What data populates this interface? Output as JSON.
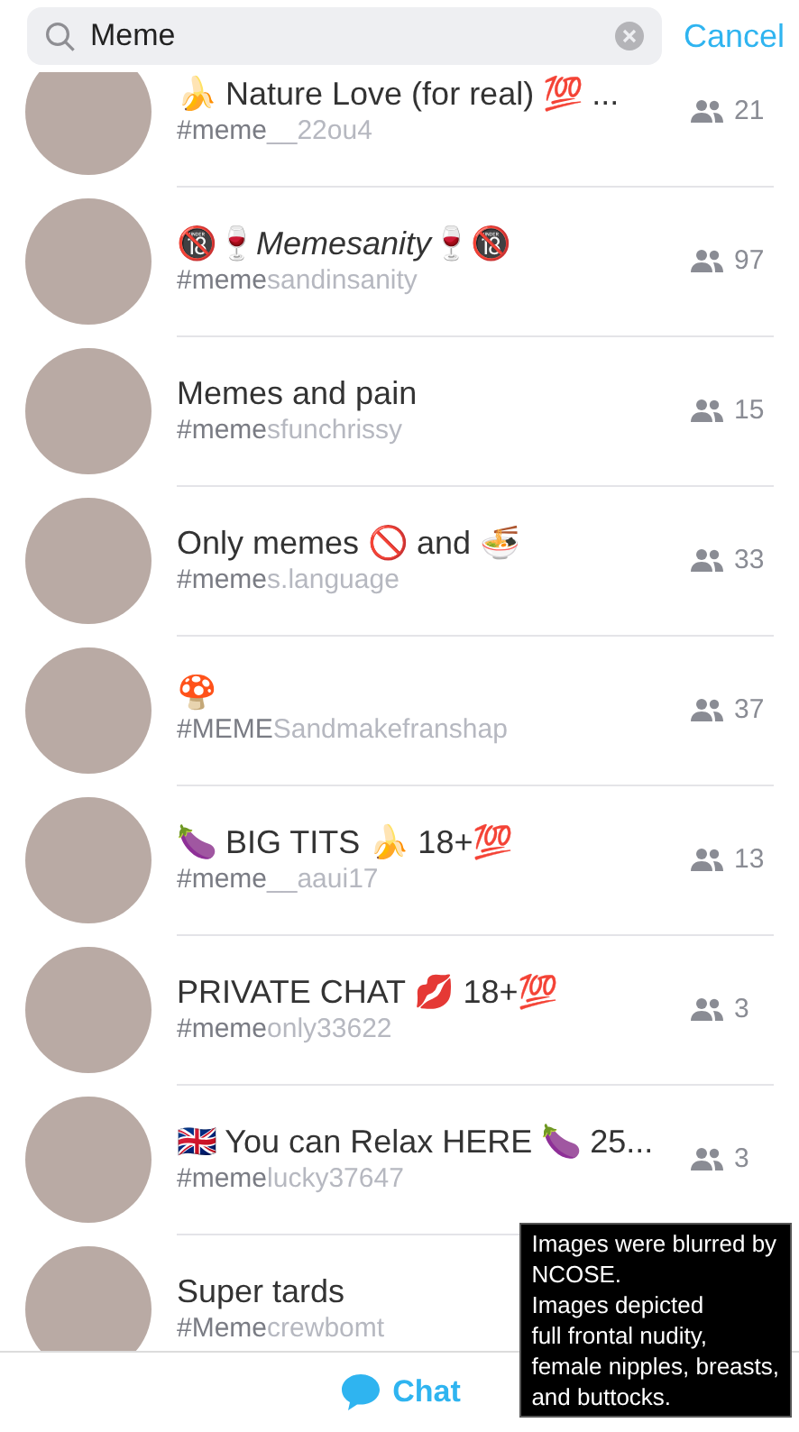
{
  "search": {
    "value": "Meme",
    "cancel": "Cancel"
  },
  "results": [
    {
      "name": "🍌 Nature Love (for real) 💯 ...",
      "handle_match": "#meme",
      "handle_rest": "__22ou4",
      "members": "21"
    },
    {
      "name": "🔞🍷*Memesanity*🍷🔞",
      "handle_match": "#meme",
      "handle_rest": "sandinsanity",
      "members": "97"
    },
    {
      "name": "Memes and pain",
      "handle_match": "#meme",
      "handle_rest": "sfunchrissy",
      "members": "15"
    },
    {
      "name": "Only memes 🚫 and 🍜",
      "handle_match": "#meme",
      "handle_rest": "s.language",
      "members": "33"
    },
    {
      "name": "🍄",
      "handle_match": "#MEME",
      "handle_rest": "Sandmakefranshap",
      "members": "37"
    },
    {
      "name": "🍆 BIG TITS 🍌 18+💯",
      "handle_match": "#meme",
      "handle_rest": "__aaui17",
      "members": "13"
    },
    {
      "name": "PRIVATE CHAT 💋 18+💯",
      "handle_match": "#meme",
      "handle_rest": "only33622",
      "members": "3"
    },
    {
      "name": "🇬🇧 You can Relax HERE 🍆 25...",
      "handle_match": "#meme",
      "handle_rest": "lucky37647",
      "members": "3"
    },
    {
      "name": "Super tards",
      "handle_match": "#Meme",
      "handle_rest": "crewbomt"
    }
  ],
  "tab_bar": {
    "label": "Chat"
  },
  "notice": [
    "Images were blurred by",
    "NCOSE.",
    "Images depicted",
    "full frontal nudity,",
    "female nipples, breasts,",
    "and buttocks."
  ]
}
